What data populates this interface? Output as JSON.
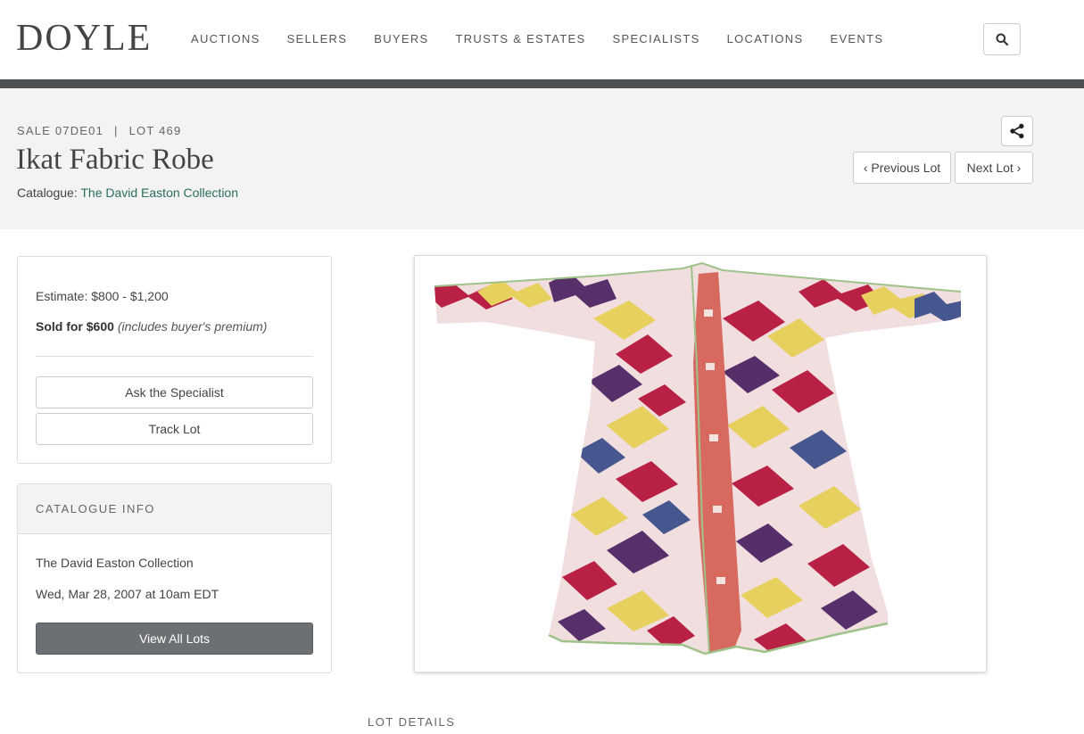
{
  "header": {
    "logo": "DOYLE",
    "nav": [
      "AUCTIONS",
      "SELLERS",
      "BUYERS",
      "TRUSTS & ESTATES",
      "SPECIALISTS",
      "LOCATIONS",
      "EVENTS"
    ],
    "search_icon": "search-icon"
  },
  "lot": {
    "sale": "SALE 07DE01",
    "separator": "|",
    "lot_number": "LOT 469",
    "title": "Ikat Fabric Robe",
    "catalogue_label": "Catalogue:",
    "catalogue_name": "The David Easton Collection",
    "prev_label": "‹ Previous Lot",
    "next_label": "Next Lot ›",
    "share_icon": "share-icon"
  },
  "estimate": {
    "estimate_text": "Estimate: $800 - $1,200",
    "sold_label": "Sold for $600",
    "sold_note": "(includes buyer's premium)",
    "ask_label": "Ask the Specialist",
    "track_label": "Track Lot"
  },
  "catalogue_info": {
    "heading": "CATALOGUE INFO",
    "name": "The David Easton Collection",
    "date": "Wed, Mar 28, 2007 at 10am EDT",
    "view_all_label": "View All Lots"
  },
  "image": {
    "subject": "robe-photo",
    "colors": {
      "ground": "#f1dedf",
      "crimson": "#b5173c",
      "yellow": "#e7cf57",
      "purple": "#4e2564",
      "blue": "#3d4f8a",
      "lining": "#d7695e",
      "trim": "#9fc28a"
    }
  },
  "lot_details_heading": "LOT DETAILS",
  "theme": {
    "link_color": "#2a6d5b",
    "dark_bar": "#4b4f54",
    "band_bg": "#f3f3f3"
  }
}
